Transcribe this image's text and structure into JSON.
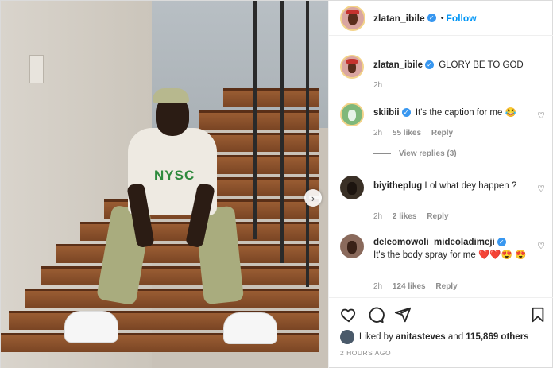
{
  "post": {
    "username": "zlatan_ibile",
    "follow_label": "Follow",
    "dot": "•",
    "verified_mark": "✓"
  },
  "photo": {
    "shirt_text": "NYSC",
    "next_glyph": "›"
  },
  "caption": {
    "username": "zlatan_ibile",
    "text": "GLORY BE TO GOD",
    "time": "2h"
  },
  "comments": [
    {
      "username": "skiibii",
      "verified": true,
      "text": "It's the caption for me 😂",
      "time": "2h",
      "likes": "55 likes",
      "reply": "Reply"
    },
    {
      "username": "biyitheplug",
      "verified": false,
      "text": "Lol what dey happen ?",
      "time": "2h",
      "likes": "2 likes",
      "reply": "Reply"
    },
    {
      "username": "deleomowoli_mideoladimeji",
      "verified": true,
      "text": "It's the body spray for me ❤️❤️😍 😍",
      "time": "2h",
      "likes": "124 likes",
      "reply": "Reply"
    }
  ],
  "view_replies": "View replies (3)",
  "liked_by": {
    "prefix": "Liked by",
    "user": "anitasteves",
    "suffix": "and",
    "count": "115,869 others"
  },
  "timestamp": "2 HOURS AGO",
  "icons": [
    "heart-icon",
    "comment-icon",
    "share-icon",
    "bookmark-icon"
  ],
  "colors": {
    "link": "#0095f6",
    "verified": "#3897f0",
    "muted": "#8e8e8e"
  }
}
